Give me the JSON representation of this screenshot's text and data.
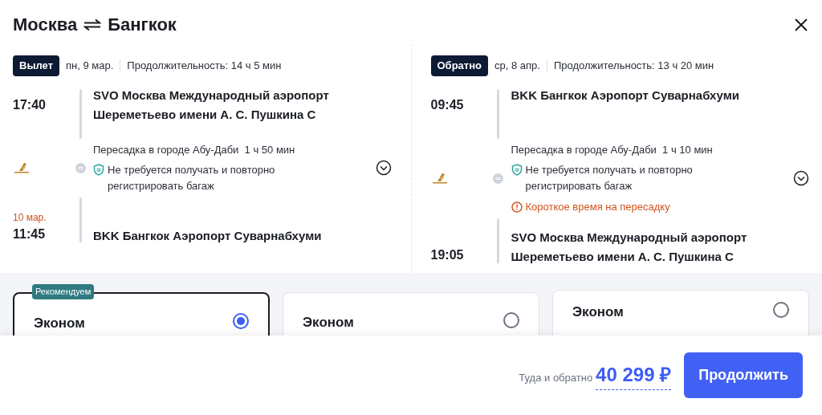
{
  "header": {
    "origin": "Москва",
    "destination": "Бангкок"
  },
  "legs": [
    {
      "badge": "Вылет",
      "date": "пн, 9 мар.",
      "duration": "Продолжительность: 14 ч 5 мин",
      "departure": {
        "time": "17:40",
        "airport": "SVO Москва Международный аэропорт Шереметьево имени А. С. Пушкина С"
      },
      "transfer": {
        "text": "Пересадка в городе Абу-Даби",
        "wait": "1 ч 50 мин",
        "baggage": "Не требуется получать и повторно регистрировать багаж",
        "warning_shown": false
      },
      "arrival": {
        "date": "10 мар.",
        "time": "11:45",
        "airport": "BKK Бангкок Аэропорт Суварнабхуми"
      }
    },
    {
      "badge": "Обратно",
      "date": "ср, 8 апр.",
      "duration": "Продолжительность: 13 ч 20 мин",
      "departure": {
        "time": "09:45",
        "airport": "BKK Бангкок Аэропорт Суварнабхуми"
      },
      "transfer": {
        "text": "Пересадка в городе Абу-Даби",
        "wait": "1 ч 10 мин",
        "baggage": "Не требуется получать и повторно регистрировать багаж",
        "warning_shown": true,
        "warning": "Короткое время на пересадку"
      },
      "arrival": {
        "time": "19:05",
        "airport": "SVO Москва Международный аэропорт Шереметьево имени А. С. Пушкина С"
      }
    }
  ],
  "fares": [
    {
      "name": "Эконом",
      "badge": "Рекомендуем",
      "selected": true
    },
    {
      "name": "Эконом",
      "selected": false
    },
    {
      "name": "Эконом",
      "selected": false
    }
  ],
  "footer": {
    "label": "Туда и обратно",
    "price": "40 299 ₽",
    "button": "Продолжить"
  }
}
